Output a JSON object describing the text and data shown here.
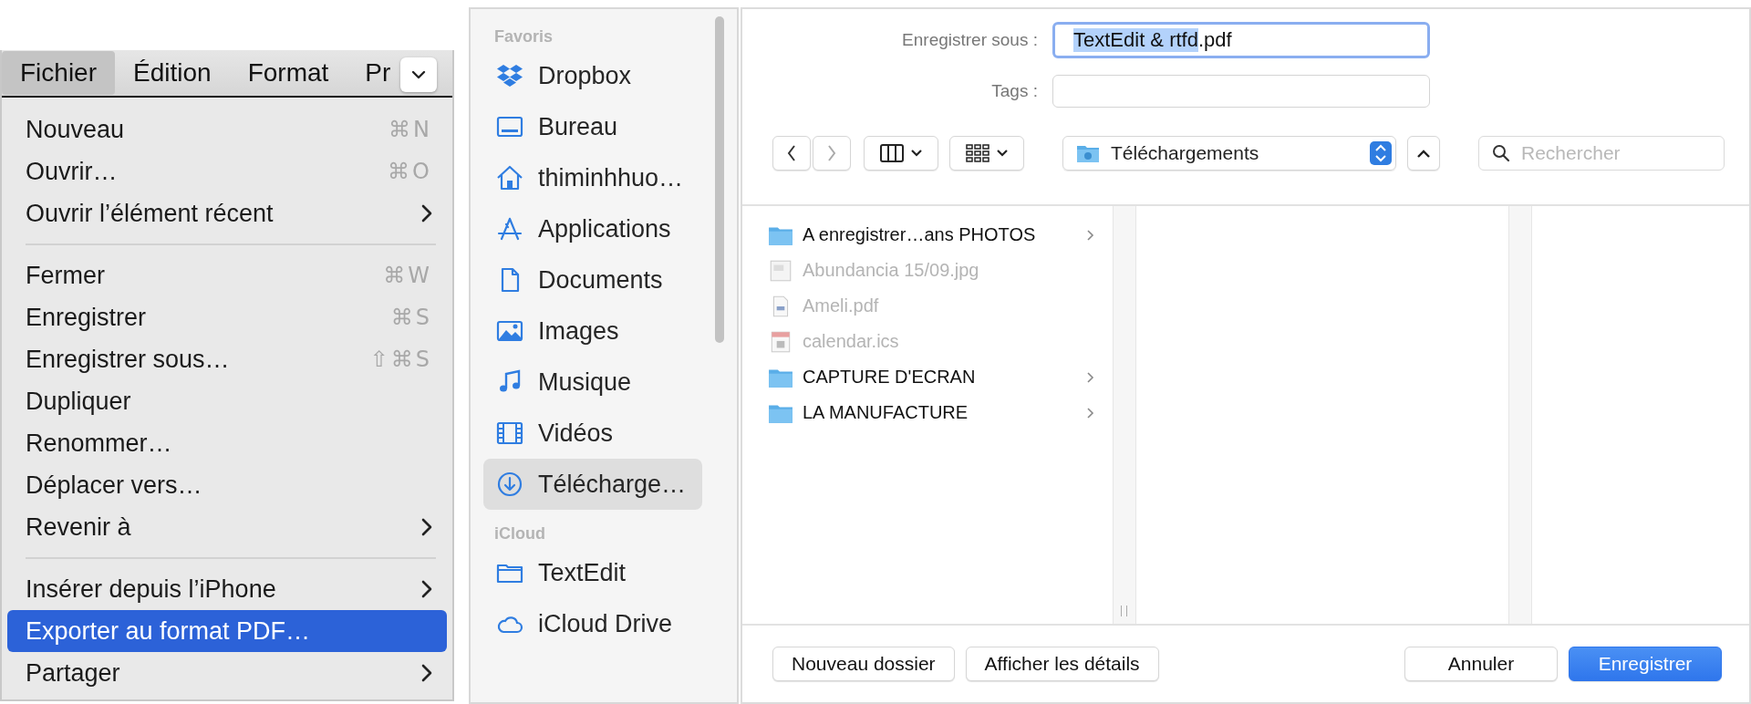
{
  "menu_bar": {
    "items": [
      {
        "label": "Fichier",
        "selected": true
      },
      {
        "label": "Édition",
        "selected": false
      },
      {
        "label": "Format",
        "selected": false
      },
      {
        "label": "Pr",
        "selected": false
      }
    ]
  },
  "menu": {
    "groups": [
      [
        {
          "label": "Nouveau",
          "shortcut": "⌘N",
          "submenu": false,
          "selected": false
        },
        {
          "label": "Ouvrir…",
          "shortcut": "⌘O",
          "submenu": false,
          "selected": false
        },
        {
          "label": "Ouvrir l’élément récent",
          "submenu": true,
          "selected": false
        }
      ],
      [
        {
          "label": "Fermer",
          "shortcut": "⌘W",
          "submenu": false,
          "selected": false
        },
        {
          "label": "Enregistrer",
          "shortcut": "⌘S",
          "submenu": false,
          "selected": false
        },
        {
          "label": "Enregistrer sous…",
          "shortcut": "⇧⌘S",
          "submenu": false,
          "selected": false
        },
        {
          "label": "Dupliquer",
          "submenu": false,
          "selected": false
        },
        {
          "label": "Renommer…",
          "submenu": false,
          "selected": false
        },
        {
          "label": "Déplacer vers…",
          "submenu": false,
          "selected": false
        },
        {
          "label": "Revenir à",
          "submenu": true,
          "selected": false
        }
      ],
      [
        {
          "label": "Insérer depuis l’iPhone",
          "submenu": true,
          "selected": false
        },
        {
          "label": "Exporter au format PDF…",
          "submenu": false,
          "selected": true
        },
        {
          "label": "Partager",
          "submenu": true,
          "selected": false
        }
      ]
    ]
  },
  "sidebar": {
    "sections": [
      {
        "title": "Favoris",
        "items": [
          {
            "label": "Dropbox",
            "selected": false
          },
          {
            "label": "Bureau",
            "selected": false
          },
          {
            "label": "thiminhhuo…",
            "selected": false
          },
          {
            "label": "Applications",
            "selected": false
          },
          {
            "label": "Documents",
            "selected": false
          },
          {
            "label": "Images",
            "selected": false
          },
          {
            "label": "Musique",
            "selected": false
          },
          {
            "label": "Vidéos",
            "selected": false
          },
          {
            "label": "Télécharge…",
            "selected": true
          }
        ]
      },
      {
        "title": "iCloud",
        "items": [
          {
            "label": "TextEdit",
            "selected": false
          },
          {
            "label": "iCloud Drive",
            "selected": false
          }
        ]
      }
    ]
  },
  "save_dialog": {
    "save_as_label": "Enregistrer sous :",
    "filename": {
      "selected_text": "TextEdit & rtfd",
      "rest": ".pdf"
    },
    "tags_label": "Tags :",
    "location": "Téléchargements",
    "search": {
      "placeholder": "Rechercher"
    }
  },
  "file_list": [
    {
      "name": "A enregistrer…ans PHOTOS",
      "kind": "folder",
      "disabled": false
    },
    {
      "name": "Abundancia 15/09.jpg",
      "kind": "image",
      "disabled": true
    },
    {
      "name": "Ameli.pdf",
      "kind": "pdf",
      "disabled": true
    },
    {
      "name": "calendar.ics",
      "kind": "calendar",
      "disabled": true
    },
    {
      "name": "CAPTURE D'ECRAN",
      "kind": "folder",
      "disabled": false
    },
    {
      "name": "LA MANUFACTURE",
      "kind": "folder",
      "disabled": false
    }
  ],
  "buttons": [
    {
      "label": "Nouveau dossier",
      "kind": "normal"
    },
    {
      "label": "Afficher les détails",
      "kind": "normal"
    },
    {
      "label": "Annuler",
      "kind": "normal"
    },
    {
      "label": "Enregistrer",
      "kind": "default"
    }
  ]
}
